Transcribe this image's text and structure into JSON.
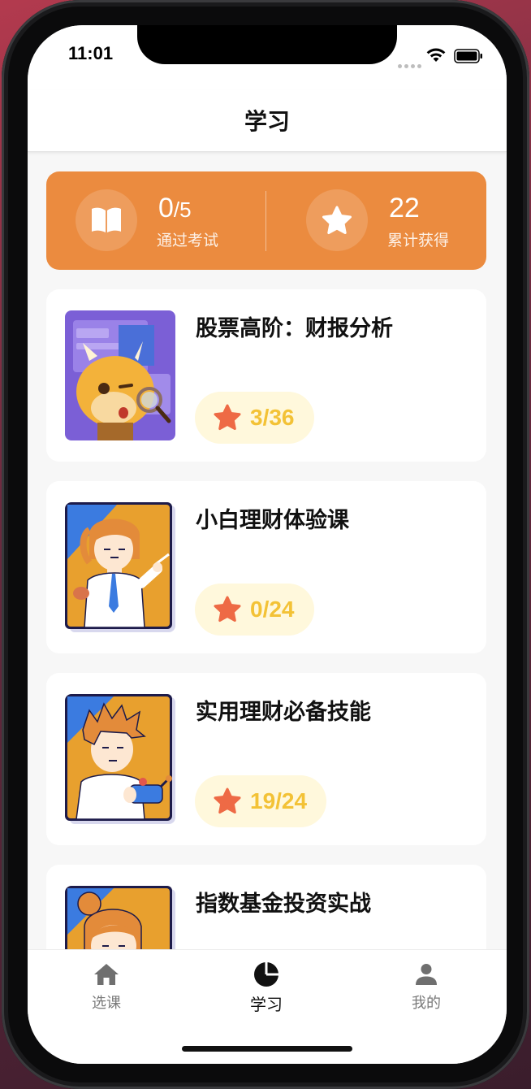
{
  "status_bar": {
    "time": "11:01"
  },
  "header": {
    "title": "学习"
  },
  "stats": {
    "exams_value": "0",
    "exams_total": "/5",
    "exams_label": "通过考试",
    "stars_value": "22",
    "stars_label": "累计获得"
  },
  "courses": [
    {
      "title": "股票高阶：财报分析",
      "progress": "3/36"
    },
    {
      "title": "小白理财体验课",
      "progress": "0/24"
    },
    {
      "title": "实用理财必备技能",
      "progress": "19/24"
    },
    {
      "title": "指数基金投资实战",
      "progress": ""
    }
  ],
  "tabs": [
    {
      "label": "选课",
      "icon": "home-icon"
    },
    {
      "label": "学习",
      "icon": "pie-chart-icon"
    },
    {
      "label": "我的",
      "icon": "person-icon"
    }
  ],
  "colors": {
    "accent_orange": "#eb8b3f",
    "star_red": "#ee6a45",
    "progress_yellow": "#f3c236",
    "badge_bg": "#fff8dc"
  }
}
